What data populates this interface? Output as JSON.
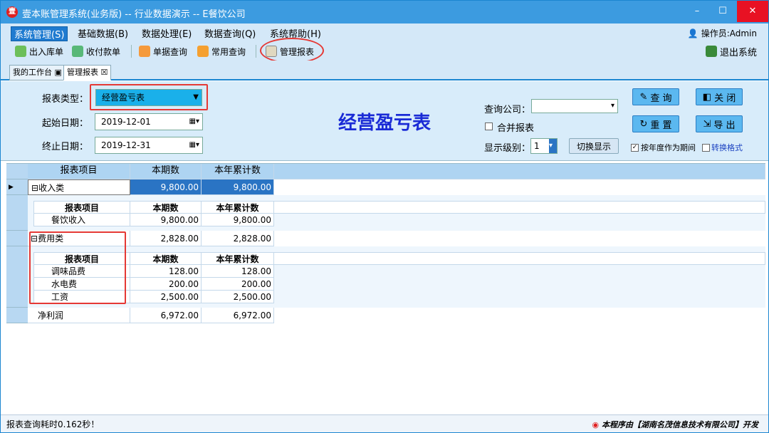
{
  "window": {
    "title": "壹本账管理系统(业务版) -- 行业数据演示 -- E餐饮公司",
    "min": "–",
    "max": "☐",
    "close": "✕"
  },
  "menus": [
    "系统管理(S)",
    "基础数据(B)",
    "数据处理(E)",
    "数据查询(Q)",
    "系统帮助(H)"
  ],
  "operator": "操作员:Admin",
  "toolbar": {
    "in_out": "出入库单",
    "pay": "收付款单",
    "doc_query": "单据查询",
    "common_query": "常用查询",
    "report": "管理报表",
    "exit": "退出系统"
  },
  "tabs": [
    "我的工作台",
    "管理报表"
  ],
  "filter": {
    "type_label": "报表类型：",
    "type_value": "经营盈亏表",
    "start_label": "起始日期：",
    "start_value": "2019-12-01",
    "end_label": "终止日期：",
    "end_value": "2019-12-31",
    "title": "经营盈亏表",
    "company_label": "查询公司：",
    "merge_label": "合并报表",
    "level_label": "显示级别：",
    "level_value": "1",
    "switch_btn": "切换显示",
    "year_period": "按年度作为期间",
    "convert": "转换格式",
    "query_btn": "查 询",
    "close_btn": "关 闭",
    "reset_btn": "重 置",
    "export_btn": "导 出"
  },
  "grid": {
    "headers": [
      "报表项目",
      "本期数",
      "本年累计数"
    ],
    "income": {
      "name": "收入类",
      "cur": "9,800.00",
      "ytd": "9,800.00",
      "items": [
        {
          "name": "餐饮收入",
          "cur": "9,800.00",
          "ytd": "9,800.00"
        }
      ]
    },
    "expense": {
      "name": "费用类",
      "cur": "2,828.00",
      "ytd": "2,828.00",
      "items": [
        {
          "name": "调味品费",
          "cur": "128.00",
          "ytd": "128.00"
        },
        {
          "name": "水电费",
          "cur": "200.00",
          "ytd": "200.00"
        },
        {
          "name": "工资",
          "cur": "2,500.00",
          "ytd": "2,500.00"
        }
      ]
    },
    "net": {
      "name": "净利润",
      "cur": "6,972.00",
      "ytd": "6,972.00"
    }
  },
  "status": "报表查询耗时0.162秒！",
  "credit": "本程序由【湖南名茂信息技术有限公司】开发",
  "colors": {
    "accent": "#3c9be0",
    "highlight": "#e53935",
    "title_blue": "#1a2bd6"
  }
}
